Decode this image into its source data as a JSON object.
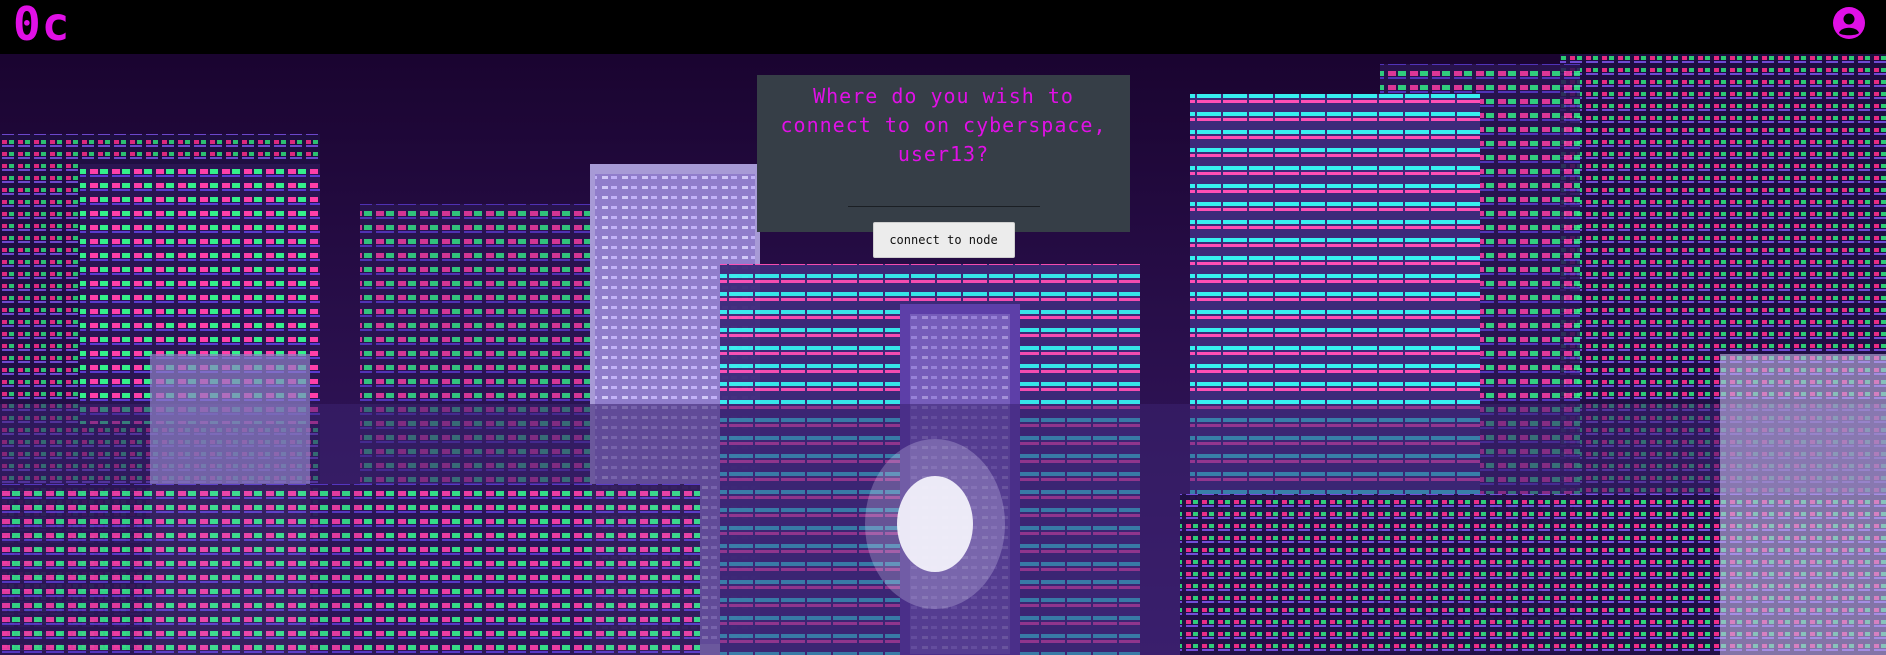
{
  "header": {
    "logo_text": "0c",
    "account_icon": "user-circle-icon"
  },
  "dialog": {
    "prompt": "Where do you wish to connect to on cyberspace, user13?",
    "input_value": "",
    "input_placeholder": "",
    "connect_button_label": "connect to node"
  },
  "colors": {
    "accent": "#e010e6",
    "topbar": "#000000",
    "dialog_bg": "#363e47",
    "button_bg": "#ececec"
  }
}
